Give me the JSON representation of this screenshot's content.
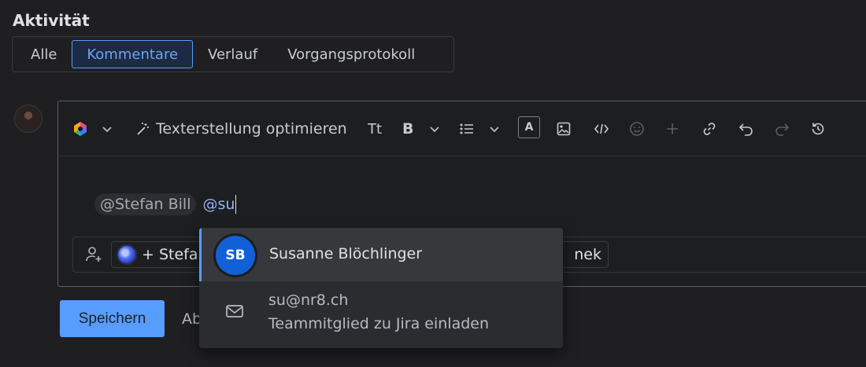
{
  "section": {
    "title": "Aktivität"
  },
  "tabs": [
    {
      "label": "Alle",
      "active": false
    },
    {
      "label": "Kommentare",
      "active": true
    },
    {
      "label": "Verlauf",
      "active": false
    },
    {
      "label": "Vorgangsprotokoll",
      "active": false
    }
  ],
  "toolbar": {
    "ai_icon": "ai-sparkle-icon",
    "improve_label": "Texterstellung optimieren",
    "text_style_label": "Tt",
    "bold_label": "B",
    "text_color_label": "A"
  },
  "editor": {
    "mention_existing": "@Stefan Bill",
    "mention_typing": "@su"
  },
  "participants": {
    "agent_chip_label": "+ Stefa",
    "right_chip_label": "nek"
  },
  "mention_dropdown": {
    "user": {
      "initials": "SB",
      "name": "Susanne Blöchlinger",
      "avatar_color": "#1160d8"
    },
    "invite": {
      "email": "su@nr8.ch",
      "label": "Teammitglied zu Jira einladen"
    }
  },
  "actions": {
    "save_label": "Speichern",
    "cancel_label": "Ab"
  },
  "colors": {
    "accent": "#579dff",
    "background": "#1f1f21"
  }
}
